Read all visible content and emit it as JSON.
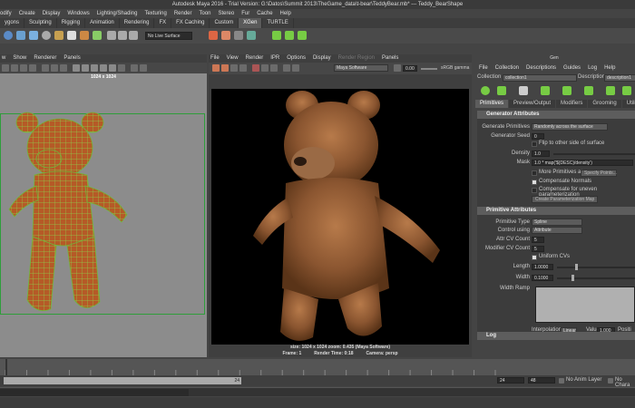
{
  "window_title": "Autodesk Maya 2016 - Trial Version: G:\\Datos\\Summit 2013\\TheGame_data\\t-bear\\TeddyBear.mb* --- Teddy_BearShape",
  "menus": [
    "odify",
    "Create",
    "Display",
    "Windows",
    "Lighting/Shading",
    "Texturing",
    "Render",
    "Toon",
    "Stereo",
    "Fur",
    "Cache",
    "Help"
  ],
  "shelf_tabs": [
    "ygons",
    "Sculpting",
    "Rigging",
    "Animation",
    "Rendering",
    "FX",
    "FX Caching",
    "Custom",
    "XGen",
    "TURTLE"
  ],
  "shelf_active": "XGen",
  "shelf": {
    "live_surface": "No Live Surface"
  },
  "viewport": {
    "menu": [
      "w",
      "Show",
      "Renderer",
      "Panels"
    ],
    "resolution": "1024 x 1024",
    "camera": "persp"
  },
  "render_view": {
    "menu": [
      "File",
      "View",
      "Render",
      "IPR",
      "Options",
      "Display",
      "Render Region",
      "Panels"
    ],
    "renderer": "Maya Software",
    "exposure": "0.00",
    "color_space": "sRGB gamma",
    "info_line1": "size: 1024 x 1024  zoom: 0.435        (Maya Software)",
    "frame": "Frame: 1",
    "render_time": "Render Time: 0:18",
    "camera": "Camera: persp"
  },
  "xgen": {
    "panel_title": "Gen",
    "menu": [
      "File",
      "Collection",
      "Descriptions",
      "Guides",
      "Log",
      "Help"
    ],
    "collection_label": "Collection",
    "collection_value": "collection1",
    "description_label": "Description",
    "description_value": "description1",
    "tabs": [
      "Primitives",
      "Preview/Output",
      "Modifiers",
      "Grooming",
      "Utilities"
    ],
    "active_tab": "Primitives",
    "generator": {
      "header": "Generator Attributes",
      "generate_label": "Generate Primitives",
      "generate_value": "Randomly across the surface",
      "seed_label": "Generator Seed",
      "seed_value": "0",
      "flip_label": "Flip to other side of surface",
      "density_label": "Density",
      "density_value": "1.0",
      "mask_label": "Mask",
      "mask_value": "1.0 * map('${DESC}/density')",
      "more_prims_label": "More Primitives at",
      "specify_points": "Specify Points...",
      "compensate_label": "Compensate Normals",
      "compensate_param_label": "Compensate for uneven parameterization",
      "create_param_map": "Create Parameterization Map"
    },
    "primitive": {
      "header": "Primitive Attributes",
      "type_label": "Primitive Type",
      "type_value": "Spline",
      "control_label": "Control using",
      "control_value": "Attribute",
      "cv_label": "Attr CV Count",
      "cv_value": "5",
      "mod_cv_label": "Modifier CV Count",
      "mod_cv_value": "5",
      "uniform_label": "Uniform CVs",
      "length_label": "Length",
      "length_value": "1.0000",
      "width_label": "Width",
      "width_value": "0.1000",
      "ramp_label": "Width Ramp",
      "interp_label": "Interpolation",
      "interp_value": "Linear",
      "value_label": "Value",
      "value_value": "1.000",
      "position_label": "Positi"
    },
    "log_header": "Log"
  },
  "timeline": {
    "ticks": [
      "1",
      "2",
      "3",
      "4",
      "5",
      "6",
      "7",
      "8",
      "9",
      "10",
      "11",
      "12",
      "13",
      "14",
      "15",
      "16",
      "17",
      "18",
      "19",
      "20",
      "21",
      "22",
      "23",
      "24"
    ],
    "current_frame": "1",
    "range_start": "1",
    "range_end": "24",
    "end_a": "24",
    "end_b": "48",
    "anim_layer": "No Anim Layer",
    "char_set": "No Chara"
  },
  "colors": {
    "accent_tab": "#5a5a5a",
    "section": "#5d5d5d",
    "wire_green": "#7fbf4a",
    "mesh_orange": "#b8602a"
  }
}
